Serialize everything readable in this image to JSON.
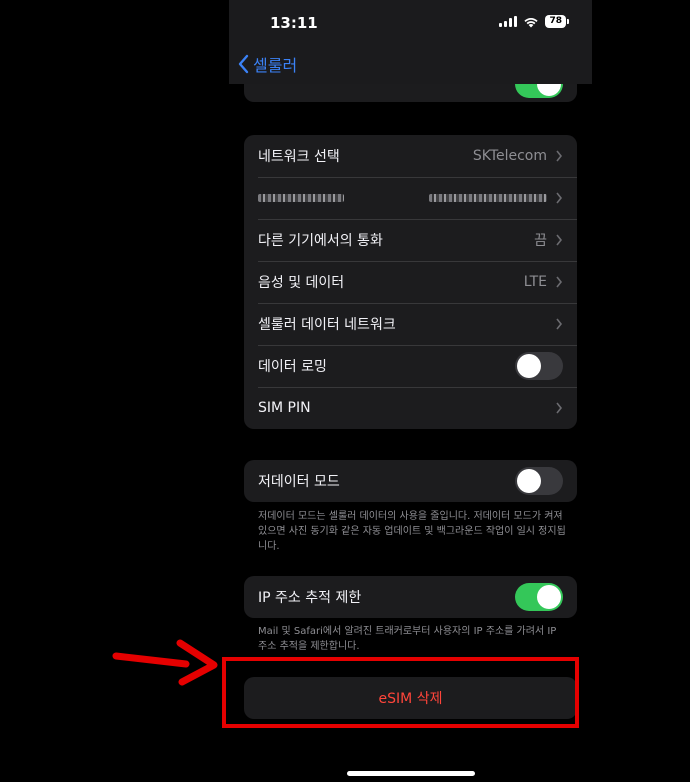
{
  "status_bar": {
    "time": "13:11",
    "battery": "78"
  },
  "nav": {
    "back_label": "셀룰러"
  },
  "network_group": {
    "rows": [
      {
        "label": "네트워크 선택",
        "value": "SKTelecom"
      },
      {
        "label": "",
        "value": ""
      },
      {
        "label": "다른 기기에서의 통화",
        "value": "끔"
      },
      {
        "label": "음성 및 데이터",
        "value": "LTE"
      },
      {
        "label": "셀룰러 데이터 네트워크",
        "value": ""
      },
      {
        "label": "데이터 로밍",
        "toggle": "off"
      },
      {
        "label": "SIM PIN",
        "value": ""
      }
    ]
  },
  "low_data": {
    "label": "저데이터 모드",
    "toggle": "off",
    "footnote": "저데이터 모드는 셀룰러 데이터의 사용을 줄입니다. 저데이터 모드가 켜져 있으면 사진 동기화 같은 자동 업데이트 및 백그라운드 작업이 일시 정지됩니다."
  },
  "ip_tracking": {
    "label": "IP 주소 추적 제한",
    "toggle": "on",
    "footnote": "Mail 및 Safari에서 알려진 트래커로부터 사용자의 IP 주소를 가려서 IP 주소 추적을 제한합니다."
  },
  "esim": {
    "delete_label": "eSIM 삭제"
  },
  "annotation": {
    "color": "#e50000"
  },
  "colors": {
    "accent": "#3b82f6",
    "destructive": "#ff453a",
    "toggle_on": "#34c759"
  }
}
